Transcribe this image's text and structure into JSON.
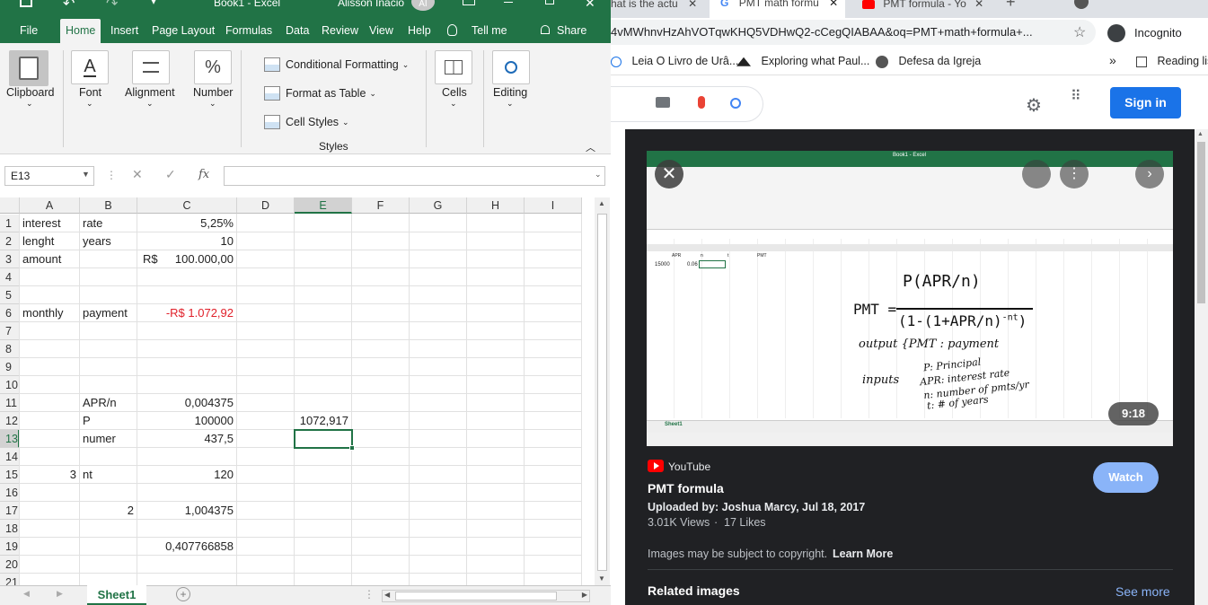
{
  "excel": {
    "title": {
      "quick_access": [
        "save",
        "undo",
        "redo",
        "customize"
      ],
      "filename": "Book1  -  Excel",
      "user": "Alisson Inácio",
      "user_initials": "AI"
    },
    "tabs": [
      "File",
      "Home",
      "Insert",
      "Page Layout",
      "Formulas",
      "Data",
      "Review",
      "View",
      "Help",
      "Tell me"
    ],
    "share_label": "Share",
    "ribbon": {
      "clipboard": "Clipboard",
      "font": "Font",
      "alignment": "Alignment",
      "number": "Number",
      "conditional_formatting": "Conditional Formatting",
      "format_as_table": "Format as Table",
      "cell_styles": "Cell Styles",
      "styles": "Styles",
      "cells": "Cells",
      "editing": "Editing"
    },
    "name_box": "E13",
    "fx": "fx",
    "columns": [
      "A",
      "B",
      "C",
      "D",
      "E",
      "F",
      "G",
      "H",
      "I"
    ],
    "rows": [
      "1",
      "2",
      "3",
      "4",
      "5",
      "6",
      "7",
      "8",
      "9",
      "10",
      "11",
      "12",
      "13",
      "14",
      "15",
      "16",
      "17",
      "18",
      "19",
      "20",
      "21"
    ],
    "cells": {
      "A1": "interest",
      "B1": "rate",
      "C1": "5,25%",
      "A2": "lenght",
      "B2": "years",
      "C2": "10",
      "C3_cur": "R$",
      "C3": "100.000,00",
      "A3": "amount",
      "A6": "monthly",
      "B6": "payment",
      "C6": "-R$ 1.072,92",
      "B11": "APR/n",
      "C11": "0,004375",
      "B12": "P",
      "C12": "100000",
      "E12": "1072,917",
      "B13": "numer",
      "C13": "437,5",
      "A15": "3",
      "B15": "nt",
      "C15": "120",
      "B17": "2",
      "C17": "1,004375",
      "C19": "0,407766858"
    },
    "sheet_tab": "Sheet1"
  },
  "browser": {
    "tabs": [
      "hat is the actu",
      "PMT math formu",
      "PMT formula - Yo"
    ],
    "url": "4vMWhnvHzAhVOTqwKHQ5VDHwQ2-cCegQIABAA&oq=PMT+math+formula+...",
    "incognito": "Incognito",
    "bookmarks": [
      "Leia O Livro de Urâ...",
      "Exploring what Paul...",
      "Defesa da Igreja",
      "Reading lis"
    ],
    "sign_in": "Sign in",
    "video": {
      "duration": "9:18",
      "source": "YouTube",
      "title": "PMT formula",
      "uploaded": "Uploaded by: Joshua Marcy, Jul 18, 2017",
      "views": "3.01K Views",
      "likes": "17 Likes",
      "watch": "Watch",
      "copyright": "Images may be subject to copyright.",
      "learn_more": "Learn More",
      "related": "Related images",
      "see_more": "See more"
    },
    "thumb": {
      "excel_title": "Book1 - Excel",
      "cells": [
        "APR",
        "n",
        "t",
        "PMT",
        "15000",
        "0.06"
      ],
      "formula": "PMT = P(APR/n) / (1-(1+APR/n)^-nt)",
      "output": "output {PMT : payment",
      "inputs_label": "inputs",
      "inputs": [
        "P: Principal",
        "APR: interest rate",
        "n: number of pmts/yr",
        "t: # of years"
      ],
      "sheet": "Sheet1"
    }
  }
}
